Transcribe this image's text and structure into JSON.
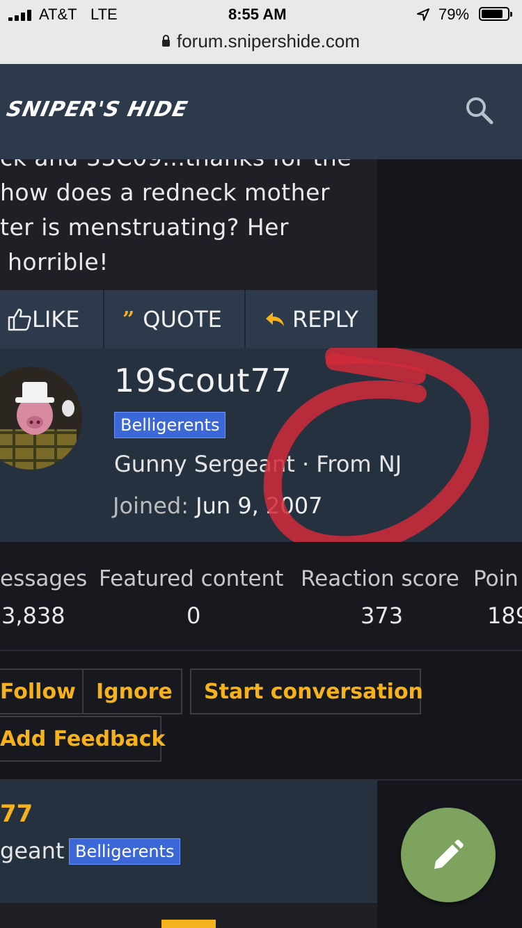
{
  "status_bar": {
    "carrier": "AT&T",
    "network": "LTE",
    "time": "8:55 AM",
    "battery": "79%",
    "url": "forum.snipershide.com"
  },
  "header": {
    "logo": "SNIPER'S HIDE"
  },
  "post": {
    "lines": [
      "ck and 33C09...thanks for the",
      "how does a redneck mother",
      "ter is menstruating? Her",
      " horrible!"
    ],
    "actions": {
      "like": "LIKE",
      "quote": "QUOTE",
      "reply": "REPLY"
    }
  },
  "profile": {
    "username": "19Scout77",
    "group_badge": "Belligerents",
    "title_line": "Gunny Sergeant · From NJ",
    "joined_label": "Joined:",
    "joined_date": "Jun 9, 2007"
  },
  "stats": [
    {
      "label": "essages",
      "value": "3,838"
    },
    {
      "label": "Featured content",
      "value": "0"
    },
    {
      "label": "Reaction score",
      "value": "373"
    },
    {
      "label": "Poin",
      "value": "189"
    }
  ],
  "buttons": {
    "follow": "Follow",
    "ignore": "Ignore",
    "start_conversation": "Start conversation",
    "add_feedback": "Add Feedback"
  },
  "next_post": {
    "name": "77",
    "rank": "geant",
    "badge": "Belligerents"
  },
  "colors": {
    "accent": "#f5b21c",
    "header_bg": "#2d3a4b",
    "badge": "#3b68d6",
    "fab": "#7da35e",
    "annotation": "#d12a3a"
  }
}
